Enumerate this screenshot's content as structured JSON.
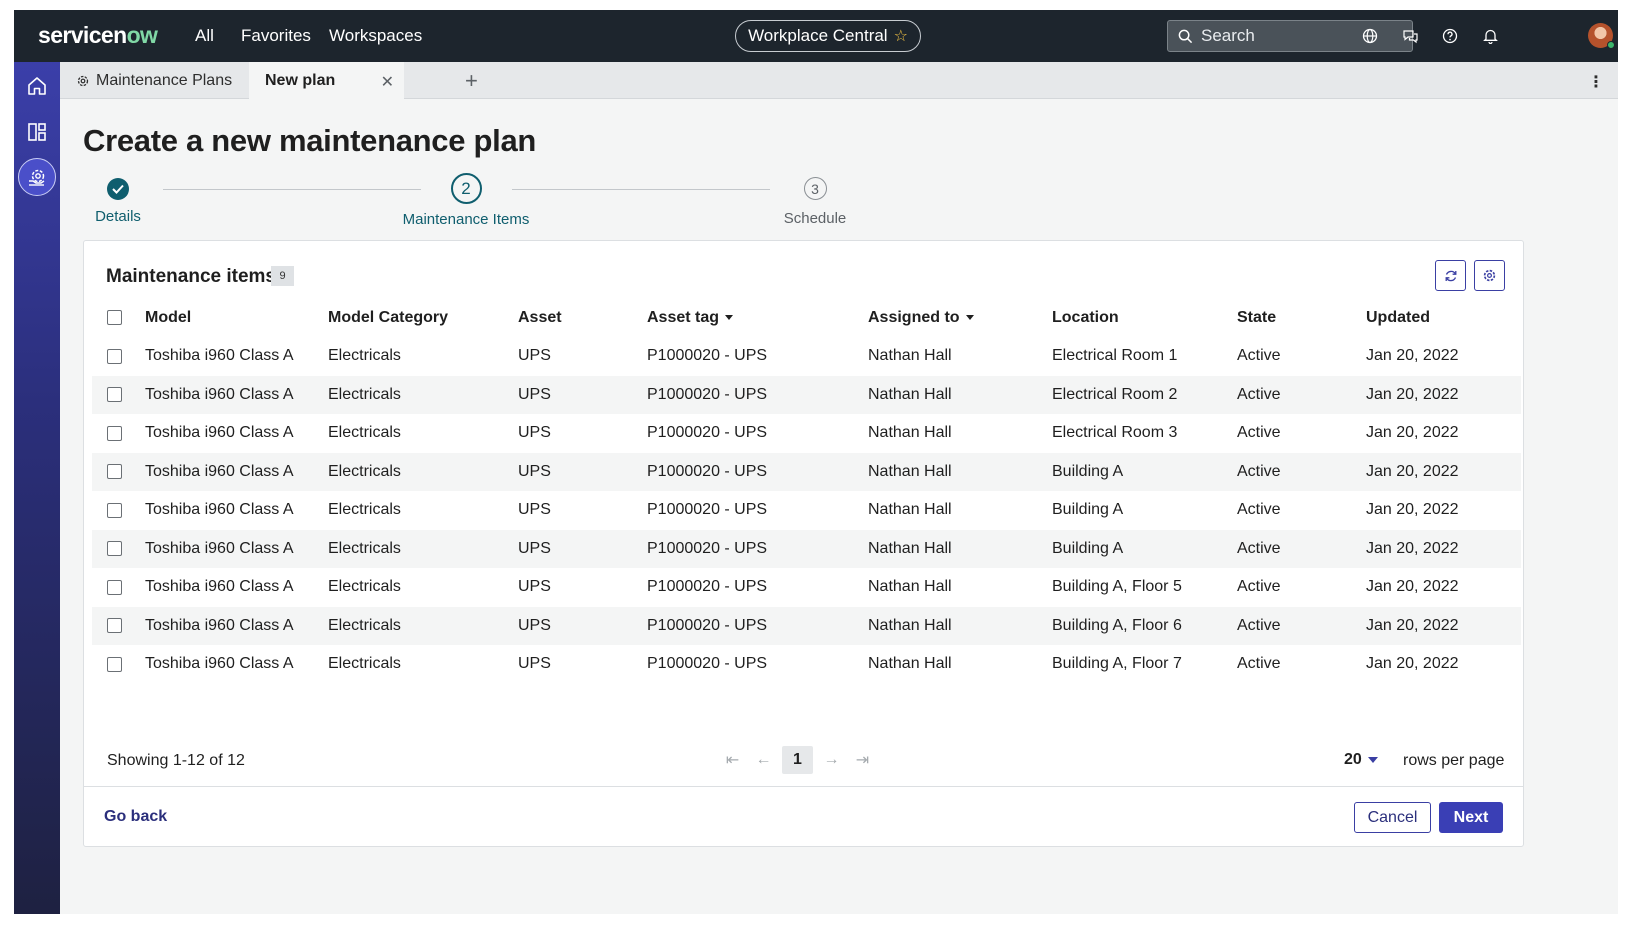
{
  "topbar": {
    "logo_main": "servicen",
    "logo_ow": "ow",
    "nav": [
      "All",
      "Favorites",
      "Workspaces"
    ],
    "workspace_pill": "Workplace Central",
    "search_placeholder": "Search",
    "icons": [
      "globe-icon",
      "chat-icon",
      "help-icon",
      "bell-icon",
      "avatar"
    ]
  },
  "rail": {
    "items": [
      "home-icon",
      "workspace-layout-icon",
      "maintenance-gear-icon"
    ]
  },
  "tabs": {
    "items": [
      {
        "label": "Maintenance Plans",
        "icon": "gear-icon"
      },
      {
        "label": "New plan",
        "active": true
      }
    ]
  },
  "page": {
    "title": "Create a new maintenance plan"
  },
  "stepper": {
    "steps": [
      {
        "number": "1",
        "label": "Details",
        "status": "complete"
      },
      {
        "number": "2",
        "label": "Maintenance Items",
        "status": "current"
      },
      {
        "number": "3",
        "label": "Schedule",
        "status": "upcoming"
      }
    ]
  },
  "items_card": {
    "title": "Maintenance items",
    "count": "9",
    "columns": [
      "Model",
      "Model Category",
      "Asset",
      "Asset tag",
      "Assigned to",
      "Location",
      "State",
      "Updated"
    ],
    "rows": [
      {
        "model": "Toshiba i960 Class A",
        "category": "Electricals",
        "asset": "UPS",
        "asset_tag": "P1000020 - UPS",
        "assigned_to": "Nathan Hall",
        "location": "Electrical Room 1",
        "state": "Active",
        "updated": "Jan 20, 2022"
      },
      {
        "model": "Toshiba i960 Class A",
        "category": "Electricals",
        "asset": "UPS",
        "asset_tag": "P1000020 - UPS",
        "assigned_to": "Nathan Hall",
        "location": "Electrical Room 2",
        "state": "Active",
        "updated": "Jan 20, 2022"
      },
      {
        "model": "Toshiba i960 Class A",
        "category": "Electricals",
        "asset": "UPS",
        "asset_tag": "P1000020 - UPS",
        "assigned_to": "Nathan Hall",
        "location": "Electrical Room 3",
        "state": "Active",
        "updated": "Jan 20, 2022"
      },
      {
        "model": "Toshiba i960 Class A",
        "category": "Electricals",
        "asset": "UPS",
        "asset_tag": "P1000020 - UPS",
        "assigned_to": "Nathan Hall",
        "location": "Building A",
        "state": "Active",
        "updated": "Jan 20, 2022"
      },
      {
        "model": "Toshiba i960 Class A",
        "category": "Electricals",
        "asset": "UPS",
        "asset_tag": "P1000020 - UPS",
        "assigned_to": "Nathan Hall",
        "location": "Building A",
        "state": "Active",
        "updated": "Jan 20, 2022"
      },
      {
        "model": "Toshiba i960 Class A",
        "category": "Electricals",
        "asset": "UPS",
        "asset_tag": "P1000020 - UPS",
        "assigned_to": "Nathan Hall",
        "location": "Building A",
        "state": "Active",
        "updated": "Jan 20, 2022"
      },
      {
        "model": "Toshiba i960 Class A",
        "category": "Electricals",
        "asset": "UPS",
        "asset_tag": "P1000020 - UPS",
        "assigned_to": "Nathan Hall",
        "location": "Building A, Floor 5",
        "state": "Active",
        "updated": "Jan 20, 2022"
      },
      {
        "model": "Toshiba i960 Class A",
        "category": "Electricals",
        "asset": "UPS",
        "asset_tag": "P1000020 - UPS",
        "assigned_to": "Nathan Hall",
        "location": "Building A, Floor 6",
        "state": "Active",
        "updated": "Jan 20, 2022"
      },
      {
        "model": "Toshiba i960 Class A",
        "category": "Electricals",
        "asset": "UPS",
        "asset_tag": "P1000020 - UPS",
        "assigned_to": "Nathan Hall",
        "location": "Building A, Floor 7",
        "state": "Active",
        "updated": "Jan 20, 2022"
      }
    ],
    "showing": "Showing 1-12 of 12",
    "current_page": "1",
    "rows_per_page": "20",
    "rows_per_page_label": "rows per page"
  },
  "footer": {
    "go_back": "Go back",
    "cancel": "Cancel",
    "next": "Next"
  },
  "colors": {
    "topbar": "#1d252d",
    "accent": "#3a3fb5",
    "link": "#3d5fd1",
    "step_active": "#0f5e6e"
  }
}
